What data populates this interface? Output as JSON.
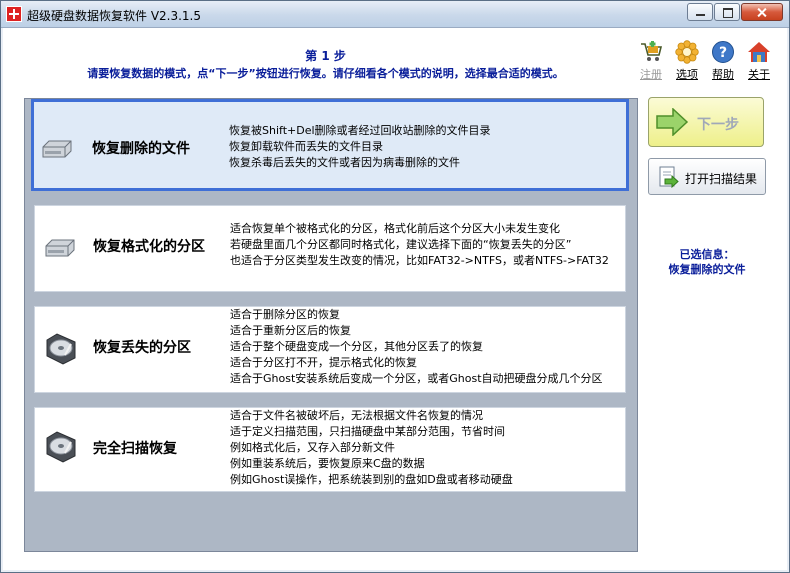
{
  "window": {
    "title": "超级硬盘数据恢复软件 V2.3.1.5"
  },
  "header": {
    "step": "第 1 步",
    "instruction": "请要恢复数据的模式，点“下一步”按钮进行恢复。请仔细看各个模式的说明，选择最合适的模式。"
  },
  "toolbar": [
    {
      "label": "注册",
      "icon": "cart-icon",
      "enabled": false
    },
    {
      "label": "选项",
      "icon": "gear-flower-icon",
      "enabled": true
    },
    {
      "label": "帮助",
      "icon": "help-icon",
      "enabled": true
    },
    {
      "label": "关于",
      "icon": "house-icon",
      "enabled": true
    }
  ],
  "modes": [
    {
      "title": "恢复删除的文件",
      "icon": "hard-disk-icon",
      "selected": true,
      "lines": [
        "恢复被Shift+Del删除或者经过回收站删除的文件目录",
        "恢复卸载软件而丢失的文件目录",
        "恢复杀毒后丢失的文件或者因为病毒删除的文件"
      ]
    },
    {
      "title": "恢复格式化的分区",
      "icon": "hard-disk-icon",
      "selected": false,
      "lines": [
        "适合恢复单个被格式化的分区，格式化前后这个分区大小未发生变化",
        "若硬盘里面几个分区都同时格式化，建议选择下面的“恢复丢失的分区”",
        "也适合于分区类型发生改变的情况，比如FAT32->NTFS，或者NTFS->FAT32"
      ]
    },
    {
      "title": "恢复丢失的分区",
      "icon": "disk-platter-icon",
      "selected": false,
      "lines": [
        "适合于删除分区的恢复",
        "适合于重新分区后的恢复",
        "适合于整个硬盘变成一个分区，其他分区丢了的恢复",
        "适合于分区打不开，提示格式化的恢复",
        "适合于Ghost安装系统后变成一个分区，或者Ghost自动把硬盘分成几个分区"
      ]
    },
    {
      "title": "完全扫描恢复",
      "icon": "disk-platter-icon",
      "selected": false,
      "lines": [
        "适合于文件名被破坏后，无法根据文件名恢复的情况",
        "适于定义扫描范围，只扫描硬盘中某部分范围，节省时间",
        "例如格式化后，又存入部分新文件",
        "例如重装系统后，要恢复原来C盘的数据",
        "例如Ghost误操作，把系统装到别的盘如D盘或者移动硬盘"
      ]
    }
  ],
  "actions": {
    "next_label": "下一步",
    "next_enabled": false,
    "open_label": "打开扫描结果"
  },
  "selection": {
    "label": "已选信息：",
    "value": "恢复删除的文件"
  }
}
